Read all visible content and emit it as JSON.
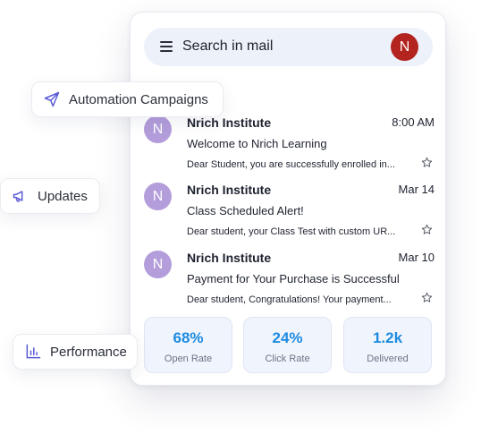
{
  "search": {
    "label": "Search in mail",
    "user_initial": "N"
  },
  "emails": [
    {
      "initial": "N",
      "sender": "Nrich Institute",
      "time": "8:00 AM",
      "subject": "Welcome to Nrich Learning",
      "preview": "Dear Student, you are successfully enrolled in..."
    },
    {
      "initial": "N",
      "sender": "Nrich Institute",
      "time": "Mar 14",
      "subject": "Class Scheduled Alert!",
      "preview": "Dear student, your Class Test with custom UR..."
    },
    {
      "initial": "N",
      "sender": "Nrich Institute",
      "time": "Mar 10",
      "subject": "Payment for Your Purchase is Successful",
      "preview": "Dear student, Congratulations! Your payment..."
    }
  ],
  "stats": [
    {
      "value": "68%",
      "label": "Open Rate"
    },
    {
      "value": "24%",
      "label": "Click Rate"
    },
    {
      "value": "1.2k",
      "label": "Delivered"
    }
  ],
  "features": {
    "automation": "Automation Campaigns",
    "updates": "Updates",
    "performance": "Performance"
  },
  "colors": {
    "accent": "#1d8be0",
    "avatar": "#b39ddb",
    "user_avatar": "#b3241f",
    "icon": "#5b5bd6"
  }
}
